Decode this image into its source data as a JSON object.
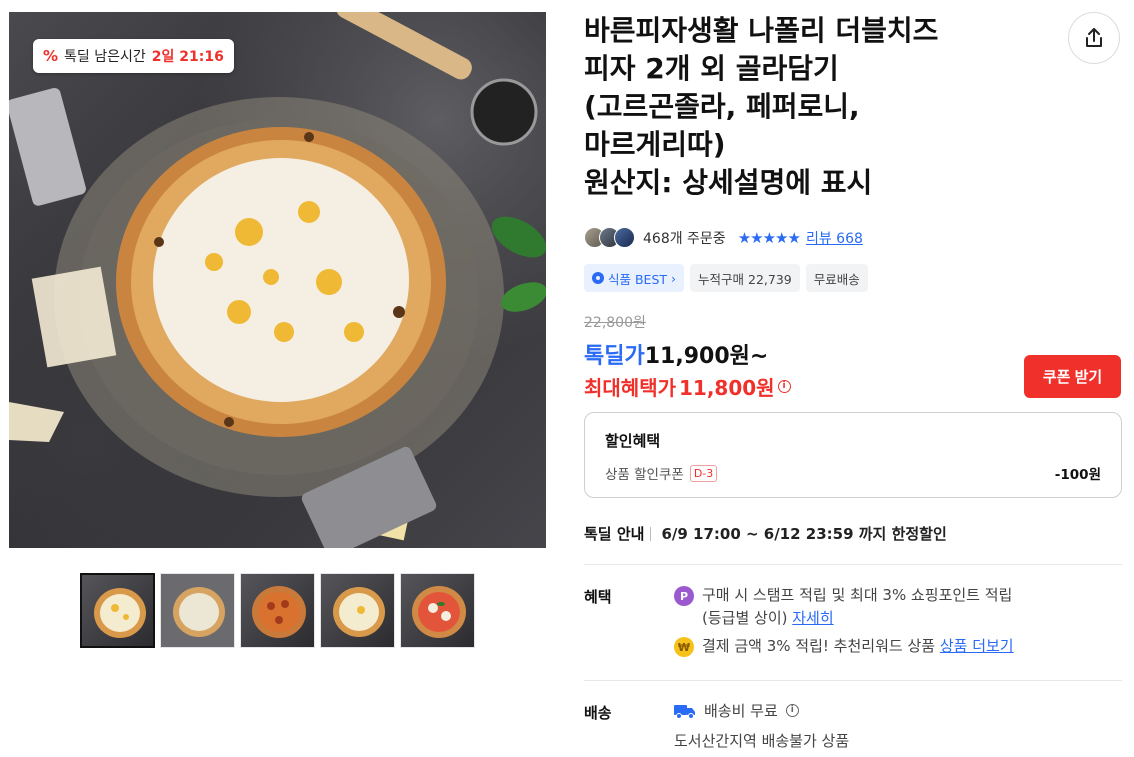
{
  "product": {
    "title_lines": [
      "바른피자생활 나폴리 더블치즈",
      "피자 2개 외 골라담기",
      "(고르곤졸라, 페퍼로니,",
      "마르게리따)",
      "원산지: 상세설명에 표시"
    ]
  },
  "deal_badge": {
    "icon": "percent-icon",
    "label": "톡딜 남은시간",
    "time": "2일 21:16"
  },
  "thumbnails": [
    {
      "name": "thumb-double-cheese",
      "active": true
    },
    {
      "name": "thumb-gorgonzola",
      "active": false
    },
    {
      "name": "thumb-pepperoni",
      "active": false
    },
    {
      "name": "thumb-cheese-2",
      "active": false
    },
    {
      "name": "thumb-margherita",
      "active": false
    }
  ],
  "meta": {
    "order_count": "468개 주문중",
    "stars": "★★★★★",
    "review_label": "리뷰 668"
  },
  "tags": {
    "best": "식품 BEST",
    "cumulative": "누적구매 22,739",
    "free_shipping": "무료배송"
  },
  "price": {
    "original": "22,800원",
    "deal_label": "톡딜가",
    "deal_value": "11,900원~",
    "max_label": "최대혜택가",
    "max_value": "11,800원",
    "coupon_button": "쿠폰 받기"
  },
  "discount": {
    "heading": "할인혜택",
    "item_label": "상품 할인쿠폰",
    "dday": "D-3",
    "amount": "-100원"
  },
  "deal_info": {
    "label": "톡딜 안내",
    "value": "6/9 17:00 ~ 6/12 23:59 까지 한정할인"
  },
  "benefits": {
    "label": "혜택",
    "line1": "구매 시 스탬프 적립 및 최대 3% 쇼핑포인트 적립",
    "line1b": "(등급별 상이) ",
    "line1_link": "자세히",
    "line2": "결제 금액 3% 적립! 추천리워드 상품 ",
    "line2_link": "상품 더보기"
  },
  "shipping": {
    "label": "배송",
    "fee": "배송비 무료",
    "note": "도서산간지역 배송불가 상품"
  },
  "colors": {
    "accent_red": "#f0302a",
    "accent_blue": "#2a6bf5"
  }
}
